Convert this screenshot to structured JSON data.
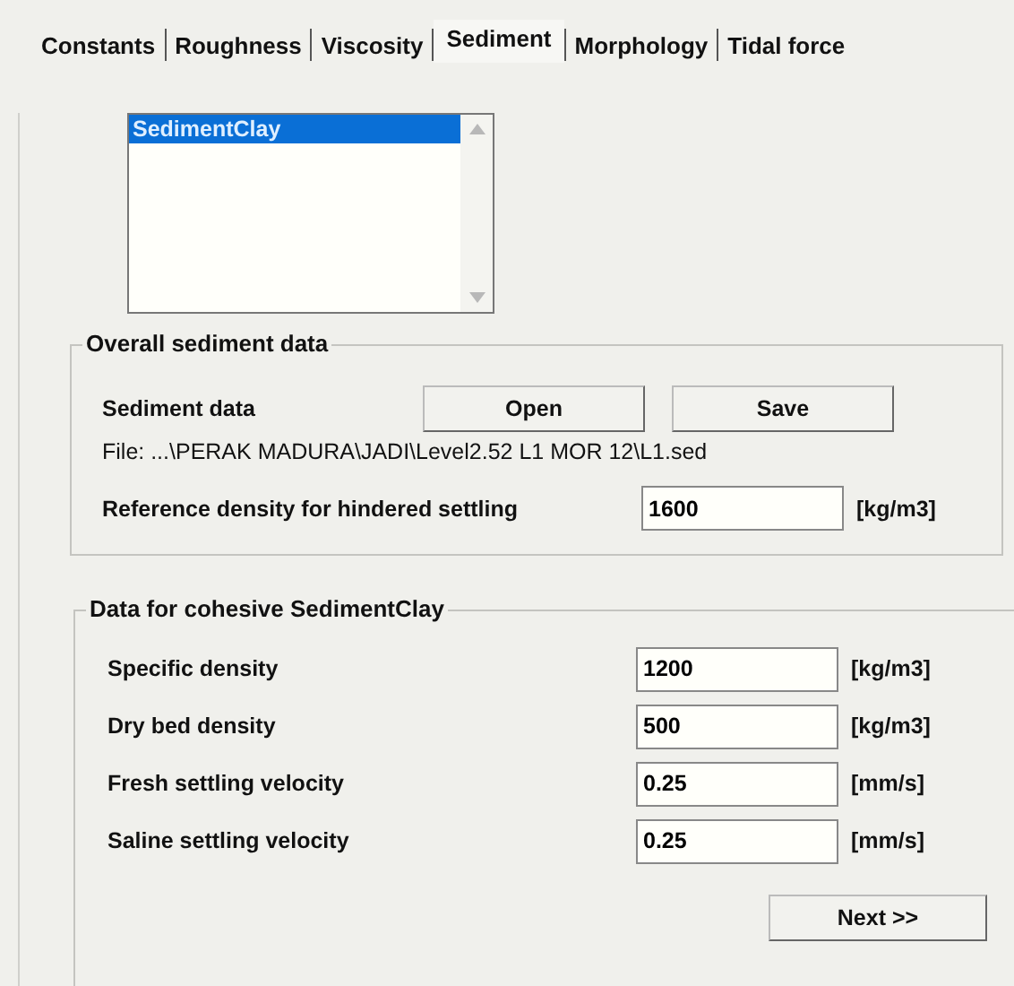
{
  "tabs": [
    {
      "label": "Constants",
      "selected": false
    },
    {
      "label": "Roughness",
      "selected": false
    },
    {
      "label": "Viscosity",
      "selected": false
    },
    {
      "label": "Sediment",
      "selected": true
    },
    {
      "label": "Morphology",
      "selected": false
    },
    {
      "label": "Tidal force",
      "selected": false
    }
  ],
  "sediment_list": {
    "items": [
      {
        "label": "SedimentClay",
        "selected": true
      }
    ]
  },
  "overall_group": {
    "title": "Overall sediment data",
    "sediment_data_label": "Sediment data",
    "buttons": [
      "Open",
      "Save"
    ],
    "file": "File:  ...\\PERAK MADURA\\JADI\\Level2.52 L1 MOR 12\\L1.sed",
    "reference": {
      "label": "Reference density for hindered settling",
      "value": "1600",
      "unit": "[kg/m3]"
    }
  },
  "cohesive_group": {
    "title": "Data for cohesive SedimentClay",
    "fields": [
      {
        "label": "Specific density",
        "value": "1200",
        "unit": "[kg/m3]"
      },
      {
        "label": "Dry bed density",
        "value": "500",
        "unit": "[kg/m3]"
      },
      {
        "label": "Fresh settling velocity",
        "value": "0.25",
        "unit": "[mm/s]"
      },
      {
        "label": "Saline settling velocity",
        "value": "0.25",
        "unit": "[mm/s]"
      }
    ],
    "next_button": "Next >>"
  }
}
